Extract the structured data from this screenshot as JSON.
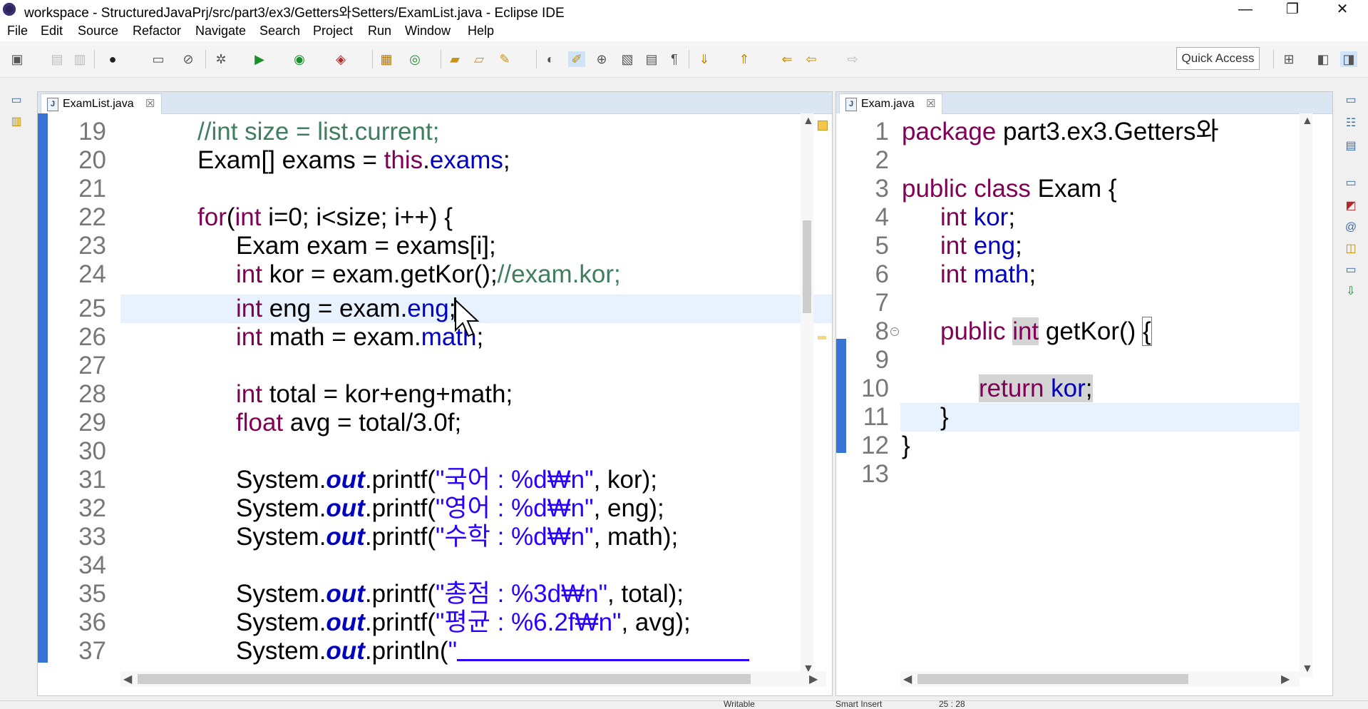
{
  "window": {
    "title": "workspace - StructuredJavaPrj/src/part3/ex3/Getters와Setters/ExamList.java - Eclipse IDE",
    "minimize": "—",
    "restore": "❐",
    "close": "✕"
  },
  "menu": [
    "File",
    "Edit",
    "Source",
    "Refactor",
    "Navigate",
    "Search",
    "Project",
    "Run",
    "Window",
    "Help"
  ],
  "toolbar": {
    "quick_access": "Quick Access"
  },
  "left_editor": {
    "tab_label": "ExamList.java",
    "close_glyph": "☒",
    "line_numbers": [
      "19",
      "20",
      "21",
      "22",
      "23",
      "24",
      "25",
      "26",
      "27",
      "28",
      "29",
      "30",
      "31",
      "32",
      "33",
      "34",
      "35",
      "36",
      "37"
    ]
  },
  "right_editor": {
    "tab_label": "Exam.java",
    "close_glyph": "☒",
    "line_numbers": [
      "1",
      "2",
      "3",
      "4",
      "5",
      "6",
      "7",
      "8",
      "9",
      "10",
      "11",
      "12",
      "13"
    ],
    "line1": {
      "kw": "package",
      "rest": " part3.ex3.Getters와"
    },
    "line3": {
      "kw1": "public",
      "kw2": "class",
      "rest": " Exam {"
    },
    "line4": {
      "kw": "int",
      "fld": "kor",
      "end": ";"
    },
    "line5": {
      "kw": "int",
      "fld": "eng",
      "end": ";"
    },
    "line6": {
      "kw": "int",
      "fld": "math",
      "end": ";"
    },
    "line8": {
      "kw1": "public",
      "kw2": "int",
      "rest": " getKor() ",
      "brace": "{"
    },
    "line10": {
      "kw": "return",
      "fld": "kor",
      "end": ";"
    },
    "line11": "}",
    "line12": "}"
  },
  "code": {
    "l19": "//int size = list.current;",
    "l20": {
      "a": "Exam[] exams = ",
      "kw": "this",
      "b": ".",
      "fld": "exams",
      "c": ";"
    },
    "l22": {
      "kw1": "for",
      "a": "(",
      "kw2": "int",
      "b": " i=0; i<size; i++) {"
    },
    "l23": "Exam exam = exams[i];",
    "l24": {
      "kw": "int",
      "a": " kor = exam.getKor();",
      "cmt": "//exam.kor;"
    },
    "l25": {
      "kw": "int",
      "a": " eng = exam.",
      "fld": "eng",
      "b": ";"
    },
    "l26": {
      "kw": "int",
      "a": " math = exam.",
      "fld": "math",
      "b": ";"
    },
    "l28": {
      "kw": "int",
      "a": " total = kor+eng+math;"
    },
    "l29": {
      "kw": "float",
      "a": " avg = total/3.0f;"
    },
    "l31": {
      "a": "System.",
      "out": "out",
      "b": ".printf(",
      "str": "\"국어 : %d₩n\"",
      "c": ", kor);"
    },
    "l32": {
      "a": "System.",
      "out": "out",
      "b": ".printf(",
      "str": "\"영어 : %d₩n\"",
      "c": ", eng);"
    },
    "l33": {
      "a": "System.",
      "out": "out",
      "b": ".printf(",
      "str": "\"수학 : %d₩n\"",
      "c": ", math);"
    },
    "l35": {
      "a": "System.",
      "out": "out",
      "b": ".printf(",
      "str": "\"총점 : %3d₩n\"",
      "c": ", total);"
    },
    "l36": {
      "a": "System.",
      "out": "out",
      "b": ".printf(",
      "str": "\"평균 : %6.2f₩n\"",
      "c": ", avg);"
    },
    "l37": {
      "a": "System.",
      "out": "out",
      "b": ".println(",
      "str": "\""
    }
  },
  "status": {
    "writable": "Writable",
    "insert": "Smart Insert",
    "position": "25 : 28"
  },
  "colors": {
    "keyword": "#7f0055",
    "field": "#0000c0",
    "string": "#2a00ff",
    "comment": "#3f7f5f",
    "ruler": "#3874d8"
  }
}
